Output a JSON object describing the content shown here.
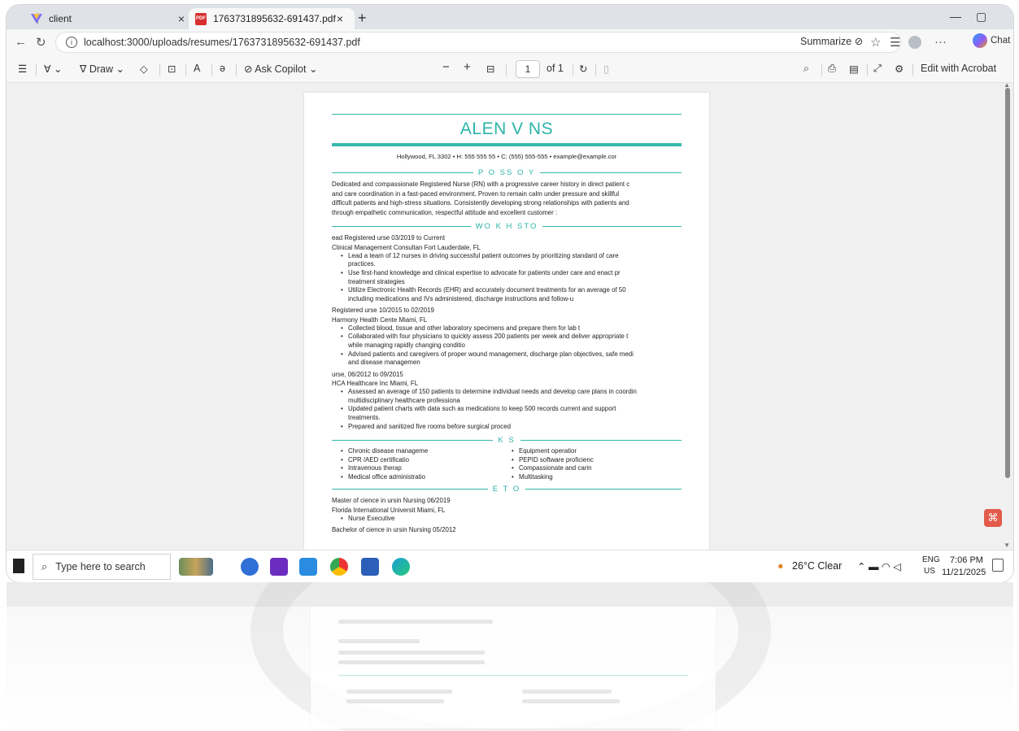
{
  "browser": {
    "tabs": [
      {
        "label": "client",
        "close": "×"
      },
      {
        "label": "1763731895632-691437.pdf",
        "close": "×"
      }
    ],
    "new_tab": "+",
    "window_min": "—",
    "window_restore": "▢",
    "url": "localhost:3000/uploads/resumes/1763731895632-691437.pdf",
    "summarize": "Summarize",
    "chat": "Chat",
    "more": "···"
  },
  "pdf_toolbar": {
    "draw": "Draw",
    "ask_copilot": "Ask Copilot",
    "page_current": "1",
    "page_of": "of 1",
    "edit_acrobat": "Edit with Acrobat",
    "minus": "−",
    "plus": "+"
  },
  "resume": {
    "name": "ALEN   V  NS",
    "contact": "Hollywood, FL 3302 • H: 555 555 55 • C: (555) 555-555 • example@example.cor",
    "sections": {
      "summary": "P O  SS O              Y",
      "work": "WO K H STO",
      "skills": "K   S",
      "education": "E    T O"
    },
    "summary_lines": [
      "Dedicated and compassionate Registered Nurse (RN) with a progressive career history in direct patient c",
      "and care coordination in a fast-paced environment. Proven to remain calm under pressure and skillful",
      "difficult patients and high-stress situations. Consistently developing strong relationships with patients and",
      "through empathetic communication, respectful attitude and excellent customer :"
    ],
    "jobs": [
      {
        "title": " ead Registered   urse 03/2019 to Current",
        "company": "Clinical Management Consultan  Fort Lauderdale, FL",
        "bullets": [
          "Lead a team of 12 nurses in driving successful patient outcomes by prioritizing standard of care",
          "practices.",
          "Use first-hand knowledge and clinical expertise to advocate for patients under care and enact pr",
          "treatment strategies",
          "Utilize Electronic Health Records (EHR) and accurately document treatments for an average of 50",
          "including medications and IVs administered, discharge instructions and follow-u"
        ]
      },
      {
        "title": "Registered   urse 10/2015 to 02/2019",
        "company": "Harmony Health Cente Miami, FL",
        "bullets": [
          "Collected blood, tissue and other laboratory specimens and prepare them for lab t",
          "Collaborated with four physicians to quickly assess 200 patients per week and deliver appropriate t",
          "while managing rapidly changing conditio",
          "Advised patients and caregivers of proper wound management, discharge plan objectives, safe medi",
          "and disease managemen"
        ]
      },
      {
        "title": " urse, 06/2012 to 09/2015",
        "company": "HCA Healthcare Inc Miami, FL",
        "bullets": [
          "Assessed an average of 150 patients to determine individual needs and develop care plans in coordin",
          "multidisciplinary healthcare professiona",
          "Updated patient charts with data such as medications to keep 500 records current and support",
          "treatments.",
          "Prepared and sanitized five rooms before surgical proced"
        ]
      }
    ],
    "skills_left": [
      "Chronic disease manageme",
      "CPR /AED certificatio",
      "Intravenous therap",
      "Medical office administratio"
    ],
    "skills_right": [
      "Equipment operatior",
      "PEPID software proficienc",
      "Compassionate and carin",
      "Multitasking"
    ],
    "education": [
      "Master of   cience in   ursin Nursing 06/2019",
      "Florida International Universit Miami, FL",
      "Nurse Executive",
      "Bachelor of   cience in   ursin Nursing 05/2012"
    ]
  },
  "taskbar": {
    "search_placeholder": "Type here to search",
    "weather": "26°C  Clear",
    "lang_top": "ENG",
    "lang_bottom": "US",
    "time": "7:06 PM",
    "date": "11/21/2025"
  },
  "colors": {
    "accent_teal": "#35b8ad",
    "pdf_red": "#d62d2d",
    "acrobat_red": "#e35b4b"
  }
}
